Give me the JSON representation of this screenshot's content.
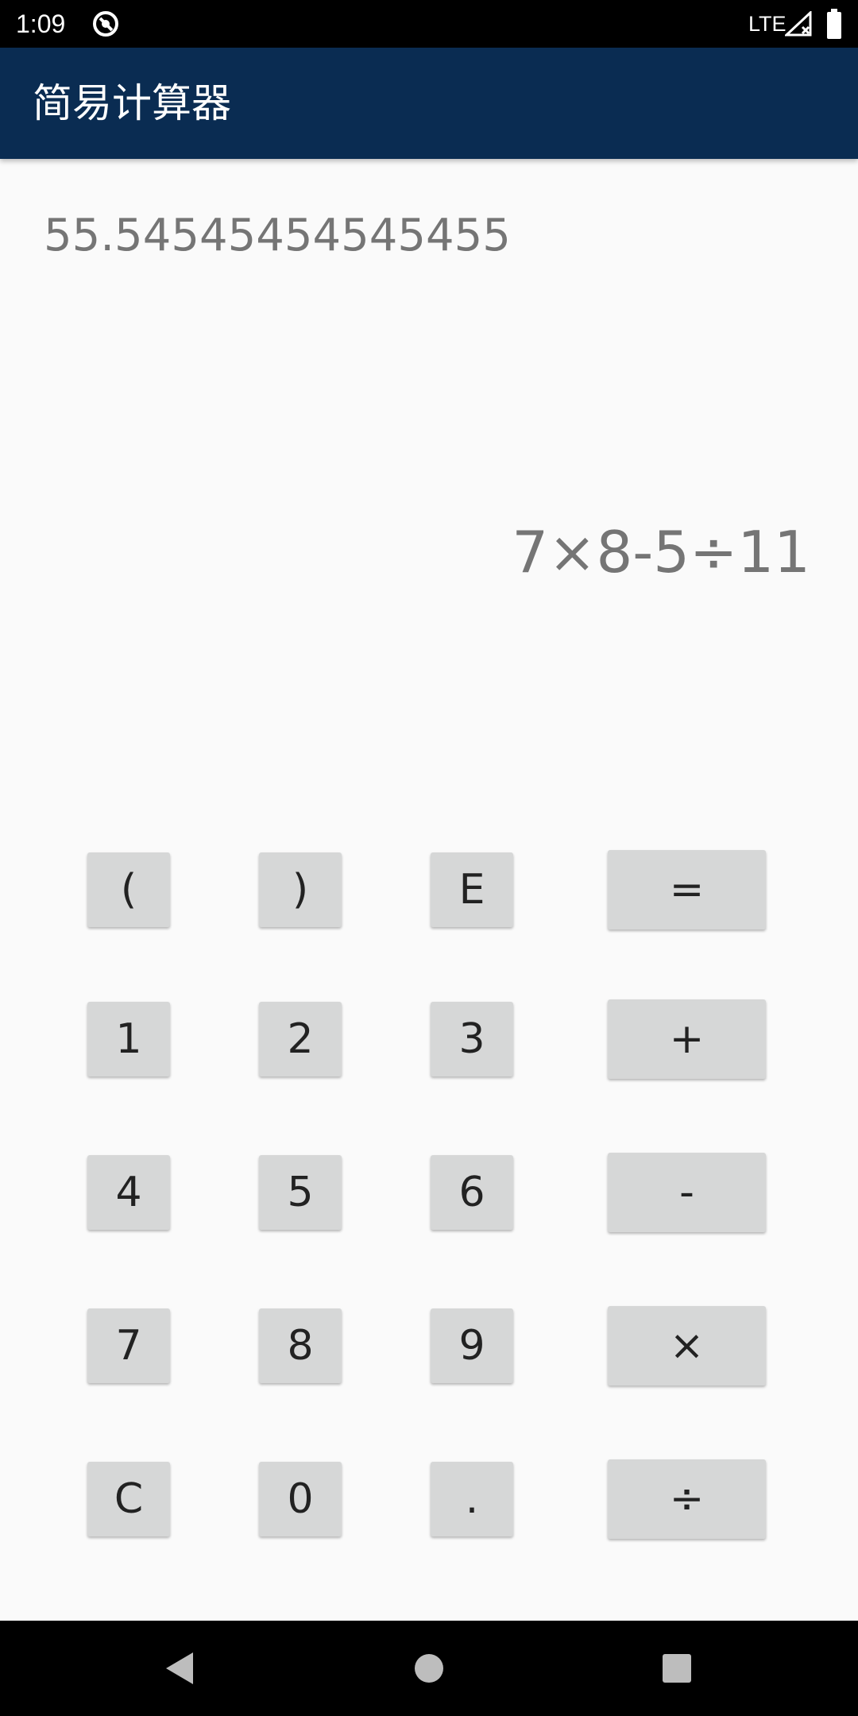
{
  "status_bar": {
    "time": "1:09",
    "network": "LTE",
    "icons": [
      "app-notification-icon",
      "signal-icon",
      "battery-icon"
    ]
  },
  "app_bar": {
    "title": "简易计算器",
    "color": "#0a2c52"
  },
  "display": {
    "result": "55.54545454545455",
    "expression": "7×8-5÷11",
    "text_color": "#757575"
  },
  "keypad": {
    "key_color": "#d6d7d7",
    "rows": [
      [
        "(",
        ")",
        "E",
        "="
      ],
      [
        "1",
        "2",
        "3",
        "+"
      ],
      [
        "4",
        "5",
        "6",
        "-"
      ],
      [
        "7",
        "8",
        "9",
        "×"
      ],
      [
        "C",
        "0",
        ".",
        "÷"
      ]
    ]
  },
  "nav_bar": {
    "icons": [
      "back-icon",
      "home-icon",
      "recents-icon"
    ]
  }
}
